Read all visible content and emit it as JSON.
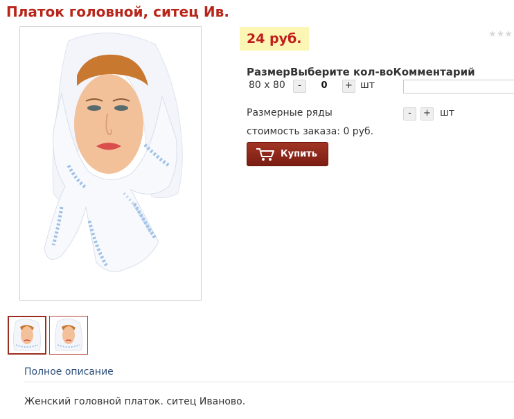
{
  "product": {
    "title": "Платок головной, ситец Ив.",
    "price": "24 руб.",
    "rating_stars": "★★★"
  },
  "order_table": {
    "header": "РазмерВыберите кол-воКомментарий",
    "row": {
      "size": "80 x 80",
      "minus": "-",
      "quantity": "0",
      "plus": "+",
      "unit": "шт"
    },
    "size_series": {
      "label": "Размерные ряды",
      "minus": "-",
      "plus": "+",
      "unit": "шт"
    },
    "order_cost": "стоимость заказа: 0 руб."
  },
  "buy_button": {
    "label": "Купить",
    "icon": "cart-icon"
  },
  "tabs": {
    "full_description": "Полное описание"
  },
  "description": "Женский головной платок. ситец Иваново.",
  "colors": {
    "title": "#b8251a",
    "price": "#c11d1d",
    "price_bg": "#fbf6b4",
    "buy_button": "#8b2818",
    "link": "#2a4d78"
  }
}
